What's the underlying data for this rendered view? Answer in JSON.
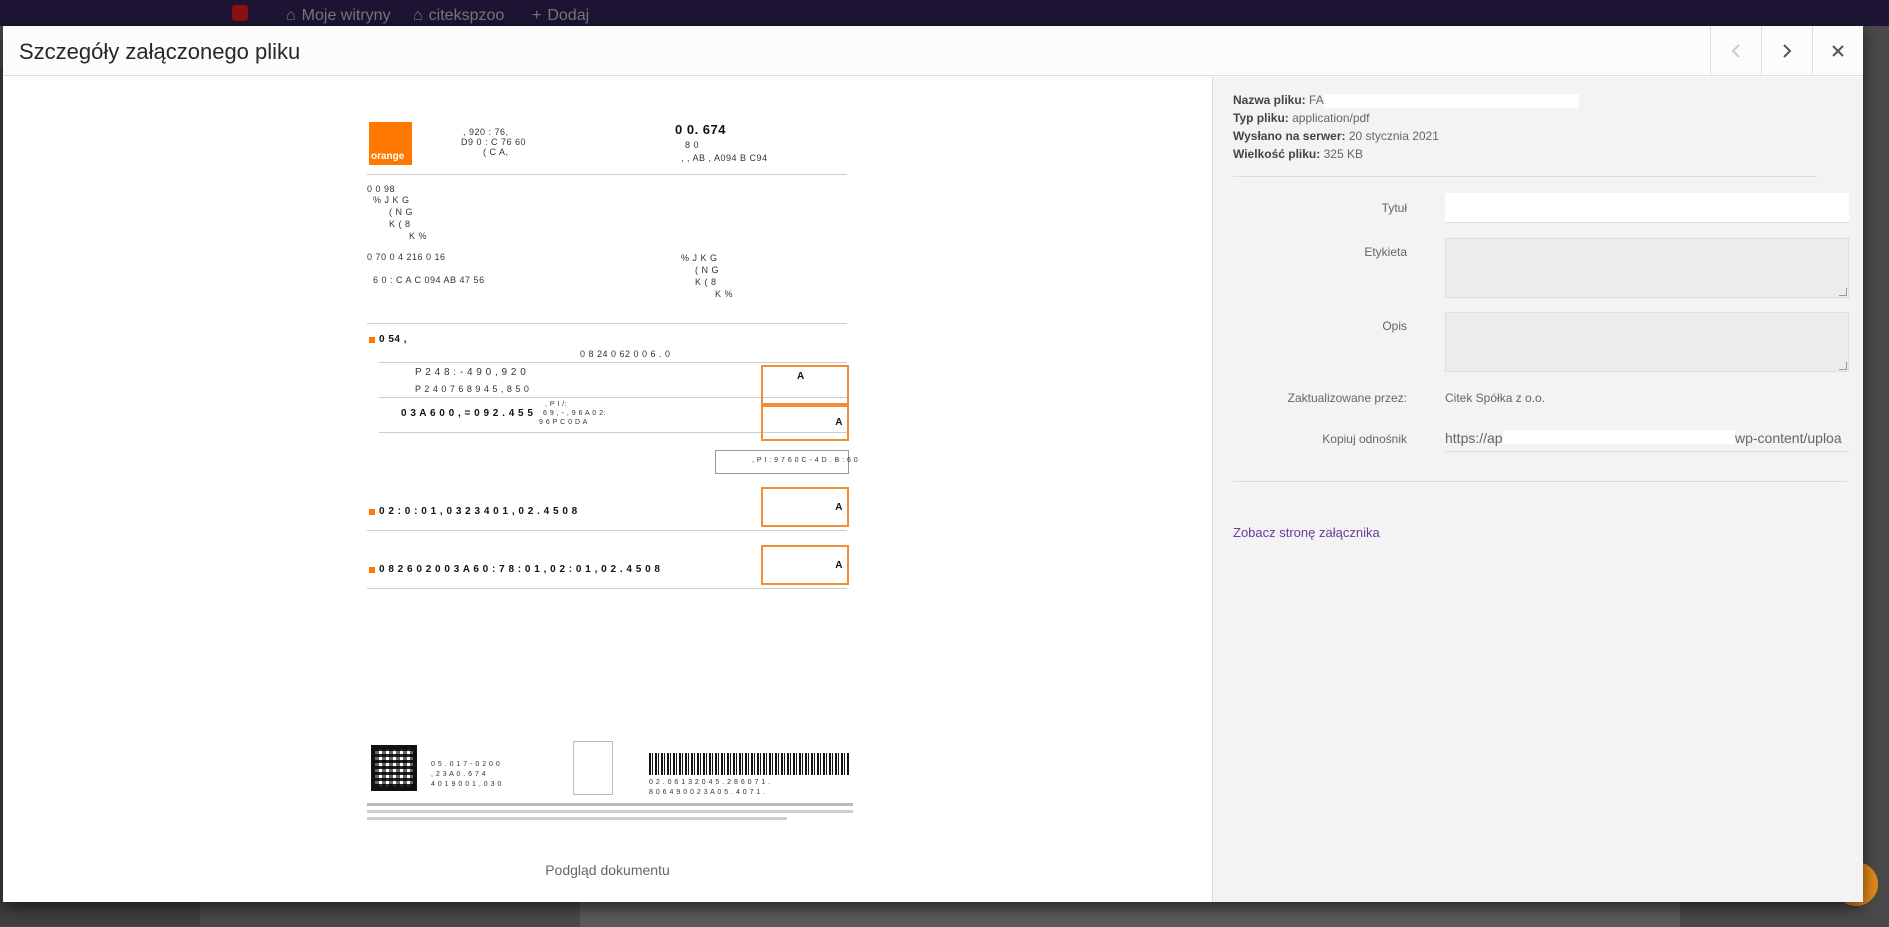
{
  "admin_bar": {
    "my_sites": "Moje witryny",
    "site_name": "citekspzoo",
    "add_new": "Dodaj"
  },
  "modal": {
    "title": "Szczegóły załączonego pliku",
    "icons": {
      "prev": "chevron-left-icon",
      "next": "chevron-right-icon",
      "close": "close-icon"
    }
  },
  "preview": {
    "caption": "Podgląd dokumentu",
    "document": {
      "logo_text": "orange",
      "lines": [
        ", 920  : 76,",
        "D9  0 : C 76  60",
        "(     C A,",
        "0 0. 674",
        "8 0",
        ", ,  AB  , A094         B C94",
        "0 0 98",
        "%     J K                        G",
        "(              N   G",
        "K      (           8",
        "K    %",
        "0 70 0 4 216 0 16",
        "6 0   :  C A C 094  AB  47 56",
        "%     J K                        G",
        "(              N   G",
        "K      (           8",
        "K    %",
        "0 54 ,",
        "0 8 24 0 62     0 0 6 .     0",
        "P 2 4 8  :  - 4 9 0      ,  9 2 0",
        "P 2 4 0 7 6  8   9 4 5  ,  8 5 0",
        ",  P I  /:",
        "6 9 ,  -  ,  9 6  A 0 2:",
        "9 6  P   C 0 D A",
        "0 3 A 6 0 0 ,  = 0 9 2 .  4 5 5",
        ",   P I  :  9 7 6 0 C  -  4 D  .  B  :  6 0",
        "0 2 :  0 :  0 1 , 0 3 2 3 4  0 1 , 0 2 .   4 5 0 8",
        "0 8  2 6 0 2 0  0 3 A 6 0 :  7 8 :  0 1 , 0 2 :  0 1 , 0 2 .   4 5 0 8",
        "0 5 .  0 1 7 - 0  2 0 0",
        ", 2 3 A 0 .  6 7 4",
        "4 0 1 9 0  0  1 , 0  3 0",
        "0 2 .  0 6 1 3  2 0  4 5 .  2 8  6 0  7 1 .",
        "8 0  6 4 9 0  0 2 3 A 0  5 .  4 0  7 1 .",
        "A",
        "A",
        "A",
        "A"
      ]
    }
  },
  "sidebar": {
    "details": {
      "filename_label": "Nazwa pliku:",
      "filename_value": "FA",
      "filetype_label": "Typ pliku:",
      "filetype_value": "application/pdf",
      "uploaded_label": "Wysłano na serwer:",
      "uploaded_value": "20 stycznia 2021",
      "size_label": "Wielkość pliku:",
      "size_value": "325 KB"
    },
    "fields": {
      "title_label": "Tytuł",
      "title_value": "",
      "caption_label": "Etykieta",
      "caption_value": "",
      "description_label": "Opis",
      "description_value": "",
      "uploaded_by_label": "Zaktualizowane przez:",
      "uploaded_by_value": "Citek Spółka z o.o.",
      "copy_link_label": "Kopiuj odnośnik",
      "copy_link_start": "https://ap",
      "copy_link_end": "wp-content/uploa"
    },
    "view_attachment_link": "Zobacz stronę załącznika"
  },
  "colors": {
    "accent_orange": "#ff7900",
    "link": "#6a3d9a",
    "admin_bar": "#1d1533"
  }
}
